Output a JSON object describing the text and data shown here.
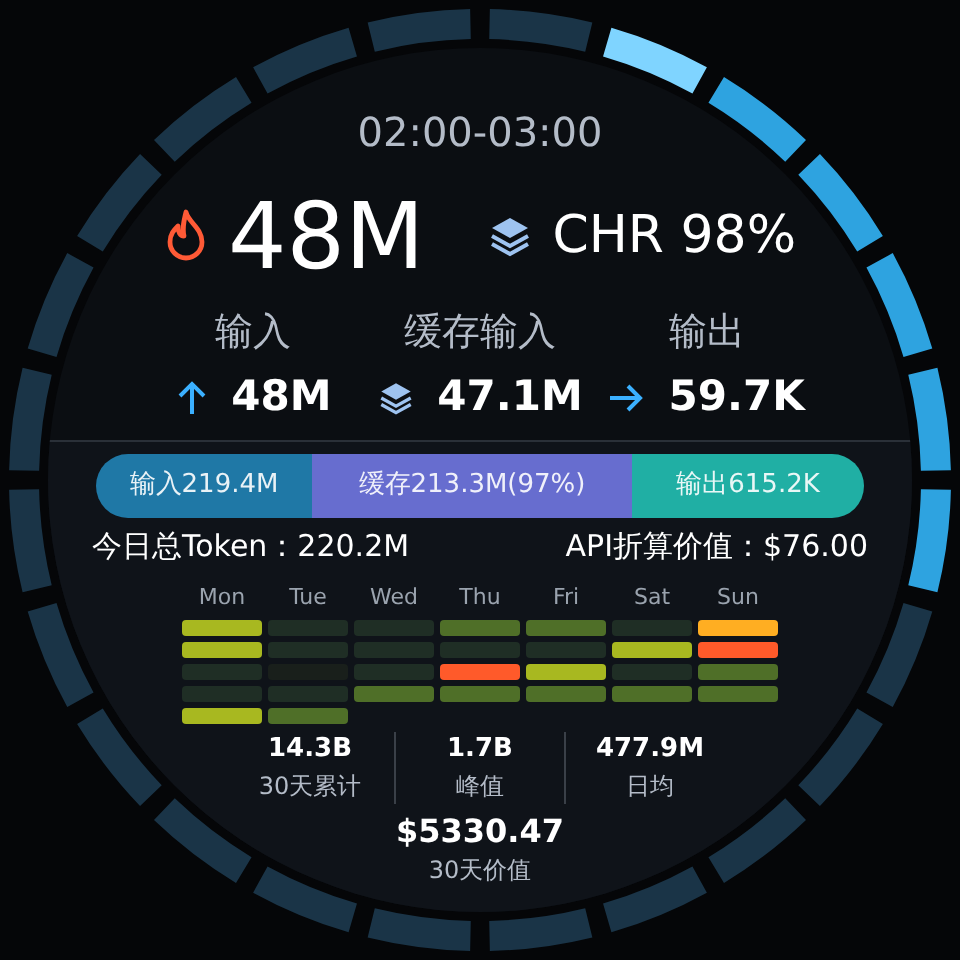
{
  "time_range": "02:00-03:00",
  "headline": {
    "total": "48M",
    "cache_hit": "CHR 98%"
  },
  "metrics": [
    {
      "label": "输入",
      "value": "48M",
      "kind": "up"
    },
    {
      "label": "缓存输入",
      "value": "47.1M",
      "kind": "cache"
    },
    {
      "label": "输出",
      "value": "59.7K",
      "kind": "right"
    }
  ],
  "breakdown": [
    {
      "label": "输入219.4M",
      "color": "#1f78a6"
    },
    {
      "label": "缓存213.3M(97%)",
      "color": "#676dcf"
    },
    {
      "label": "输出615.2K",
      "color": "#20afa4"
    }
  ],
  "summary": {
    "total": "今日总Token：220.2M",
    "cost": "API折算价值：$76.00"
  },
  "heatmap": {
    "days": [
      {
        "label": "Mon",
        "cells": [
          {
            "color": "#a8b820"
          },
          {
            "color": "#a8b820"
          },
          {
            "color": "#1f2e25"
          },
          {
            "color": "#1f2e25"
          },
          {
            "color": "#a8b820"
          }
        ]
      },
      {
        "label": "Tue",
        "cells": [
          {
            "color": "#1f2e25"
          },
          {
            "color": "#1f2e25"
          },
          {
            "color": "#191f1b"
          },
          {
            "color": "#1f2e25"
          },
          {
            "color": "#4f6f28"
          }
        ]
      },
      {
        "label": "Wed",
        "cells": [
          {
            "color": "#1f2e25"
          },
          {
            "color": "#1f2e25"
          },
          {
            "color": "#1f2e25"
          },
          {
            "color": "#4f6f28"
          }
        ]
      },
      {
        "label": "Thu",
        "cells": [
          {
            "color": "#4f6f28"
          },
          {
            "color": "#1f2e25"
          },
          {
            "color": "#ff5a2a"
          },
          {
            "color": "#4f6f28"
          }
        ]
      },
      {
        "label": "Fri",
        "cells": [
          {
            "color": "#4f6f28"
          },
          {
            "color": "#1f2e25"
          },
          {
            "color": "#a8b820"
          },
          {
            "color": "#4f6f28"
          }
        ]
      },
      {
        "label": "Sat",
        "cells": [
          {
            "color": "#1f2e25"
          },
          {
            "color": "#a8b820"
          },
          {
            "color": "#1f2e25"
          },
          {
            "color": "#4f6f28"
          }
        ]
      },
      {
        "label": "Sun",
        "cells": [
          {
            "color": "#ffae22"
          },
          {
            "color": "#ff5a2a"
          },
          {
            "color": "#4f6f28"
          },
          {
            "color": "#4f6f28"
          }
        ]
      }
    ]
  },
  "stats": [
    {
      "value": "14.3B",
      "label": "30天累计"
    },
    {
      "value": "1.7B",
      "label": "峰值"
    },
    {
      "value": "477.9M",
      "label": "日均"
    }
  ],
  "month_value": {
    "value": "$5330.47",
    "label": "30天价值"
  },
  "ring": [
    {
      "lit": false,
      "selected": false
    },
    {
      "lit": true,
      "selected": true
    },
    {
      "lit": true,
      "selected": false
    },
    {
      "lit": true,
      "selected": false
    },
    {
      "lit": true,
      "selected": false
    },
    {
      "lit": true,
      "selected": false
    },
    {
      "lit": true,
      "selected": false
    },
    {
      "lit": false,
      "selected": false
    },
    {
      "lit": false,
      "selected": false
    },
    {
      "lit": false,
      "selected": false
    },
    {
      "lit": false,
      "selected": false
    },
    {
      "lit": false,
      "selected": false
    },
    {
      "lit": false,
      "selected": false
    },
    {
      "lit": false,
      "selected": false
    },
    {
      "lit": false,
      "selected": false
    },
    {
      "lit": false,
      "selected": false
    },
    {
      "lit": false,
      "selected": false
    },
    {
      "lit": false,
      "selected": false
    },
    {
      "lit": false,
      "selected": false
    },
    {
      "lit": false,
      "selected": false
    },
    {
      "lit": false,
      "selected": false
    },
    {
      "lit": false,
      "selected": false
    },
    {
      "lit": false,
      "selected": false
    },
    {
      "lit": false,
      "selected": false
    }
  ]
}
